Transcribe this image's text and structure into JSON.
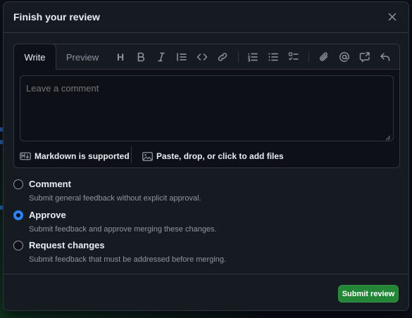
{
  "dialog": {
    "title": "Finish your review",
    "close_icon": "x-icon"
  },
  "editor": {
    "tabs": [
      {
        "label": "Write",
        "active": true
      },
      {
        "label": "Preview",
        "active": false
      }
    ],
    "toolbar": [
      {
        "name": "heading",
        "icon": "heading-icon",
        "glyph": "H"
      },
      {
        "name": "bold",
        "icon": "bold-icon"
      },
      {
        "name": "italic",
        "icon": "italic-icon"
      },
      {
        "name": "quote",
        "icon": "quote-icon"
      },
      {
        "name": "code",
        "icon": "code-icon"
      },
      {
        "name": "link",
        "icon": "link-icon"
      },
      {
        "name": "ordered-list",
        "icon": "ordered-list-icon"
      },
      {
        "name": "unordered-list",
        "icon": "unordered-list-icon"
      },
      {
        "name": "task-list",
        "icon": "task-list-icon"
      },
      {
        "name": "attach",
        "icon": "paperclip-icon"
      },
      {
        "name": "mention",
        "icon": "mention-icon"
      },
      {
        "name": "cross-reference",
        "icon": "cross-reference-icon"
      },
      {
        "name": "saved-reply",
        "icon": "reply-icon"
      }
    ],
    "placeholder": "Leave a comment",
    "value": "",
    "footer": {
      "markdown": "Markdown is supported",
      "attach": "Paste, drop, or click to add files"
    }
  },
  "review_options": [
    {
      "label": "Comment",
      "description": "Submit general feedback without explicit approval.",
      "checked": false
    },
    {
      "label": "Approve",
      "description": "Submit feedback and approve merging these changes.",
      "checked": true
    },
    {
      "label": "Request changes",
      "description": "Submit feedback that must be addressed before merging.",
      "checked": false
    }
  ],
  "submit_label": "Submit review",
  "colors": {
    "background": "#0d1117",
    "surface": "#161b22",
    "border": "#30363d",
    "accent": "#2f81f7",
    "primary_button": "#238636",
    "muted_text": "#8d96a0"
  }
}
